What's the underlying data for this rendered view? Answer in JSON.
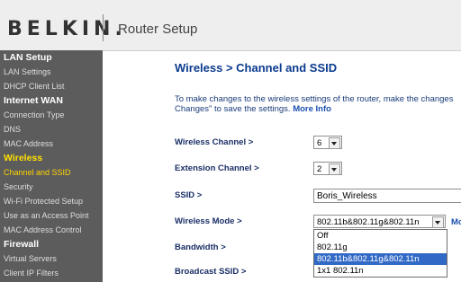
{
  "header": {
    "logo": "BELKIN.",
    "title": "Router Setup"
  },
  "sidebar": {
    "items": [
      {
        "label": "LAN Setup",
        "type": "section"
      },
      {
        "label": "LAN Settings",
        "type": "link"
      },
      {
        "label": "DHCP Client List",
        "type": "link"
      },
      {
        "label": "Internet WAN",
        "type": "section"
      },
      {
        "label": "Connection Type",
        "type": "link"
      },
      {
        "label": "DNS",
        "type": "link"
      },
      {
        "label": "MAC Address",
        "type": "link"
      },
      {
        "label": "Wireless",
        "type": "active-section"
      },
      {
        "label": "Channel and SSID",
        "type": "active"
      },
      {
        "label": "Security",
        "type": "link"
      },
      {
        "label": "Wi-Fi Protected Setup",
        "type": "link"
      },
      {
        "label": "Use as an Access Point",
        "type": "link"
      },
      {
        "label": "MAC Address Control",
        "type": "link"
      },
      {
        "label": "Firewall",
        "type": "section"
      },
      {
        "label": "Virtual Servers",
        "type": "link"
      },
      {
        "label": "Client IP Filters",
        "type": "link"
      }
    ]
  },
  "main": {
    "title": "Wireless > Channel and SSID",
    "intro_line1": "To make changes to the wireless settings of the router, make the changes",
    "intro_line2": "Changes\" to save the settings.",
    "more_info": "More Info",
    "fields": {
      "channel_label": "Wireless Channel >",
      "channel_value": "6",
      "extension_label": "Extension Channel >",
      "extension_value": "2",
      "ssid_label": "SSID >",
      "ssid_value": "Boris_Wireless",
      "mode_label": "Wireless Mode >",
      "mode_value": "802.11b&802.11g&802.11n",
      "bandwidth_label": "Bandwidth >",
      "broadcast_label": "Broadcast SSID >"
    },
    "mode_options": [
      "Off",
      "802.11g",
      "802.11b&802.11g&802.11n",
      "1x1 802.11n"
    ],
    "mode_selected_index": 2,
    "mode_more": "Mo"
  }
}
